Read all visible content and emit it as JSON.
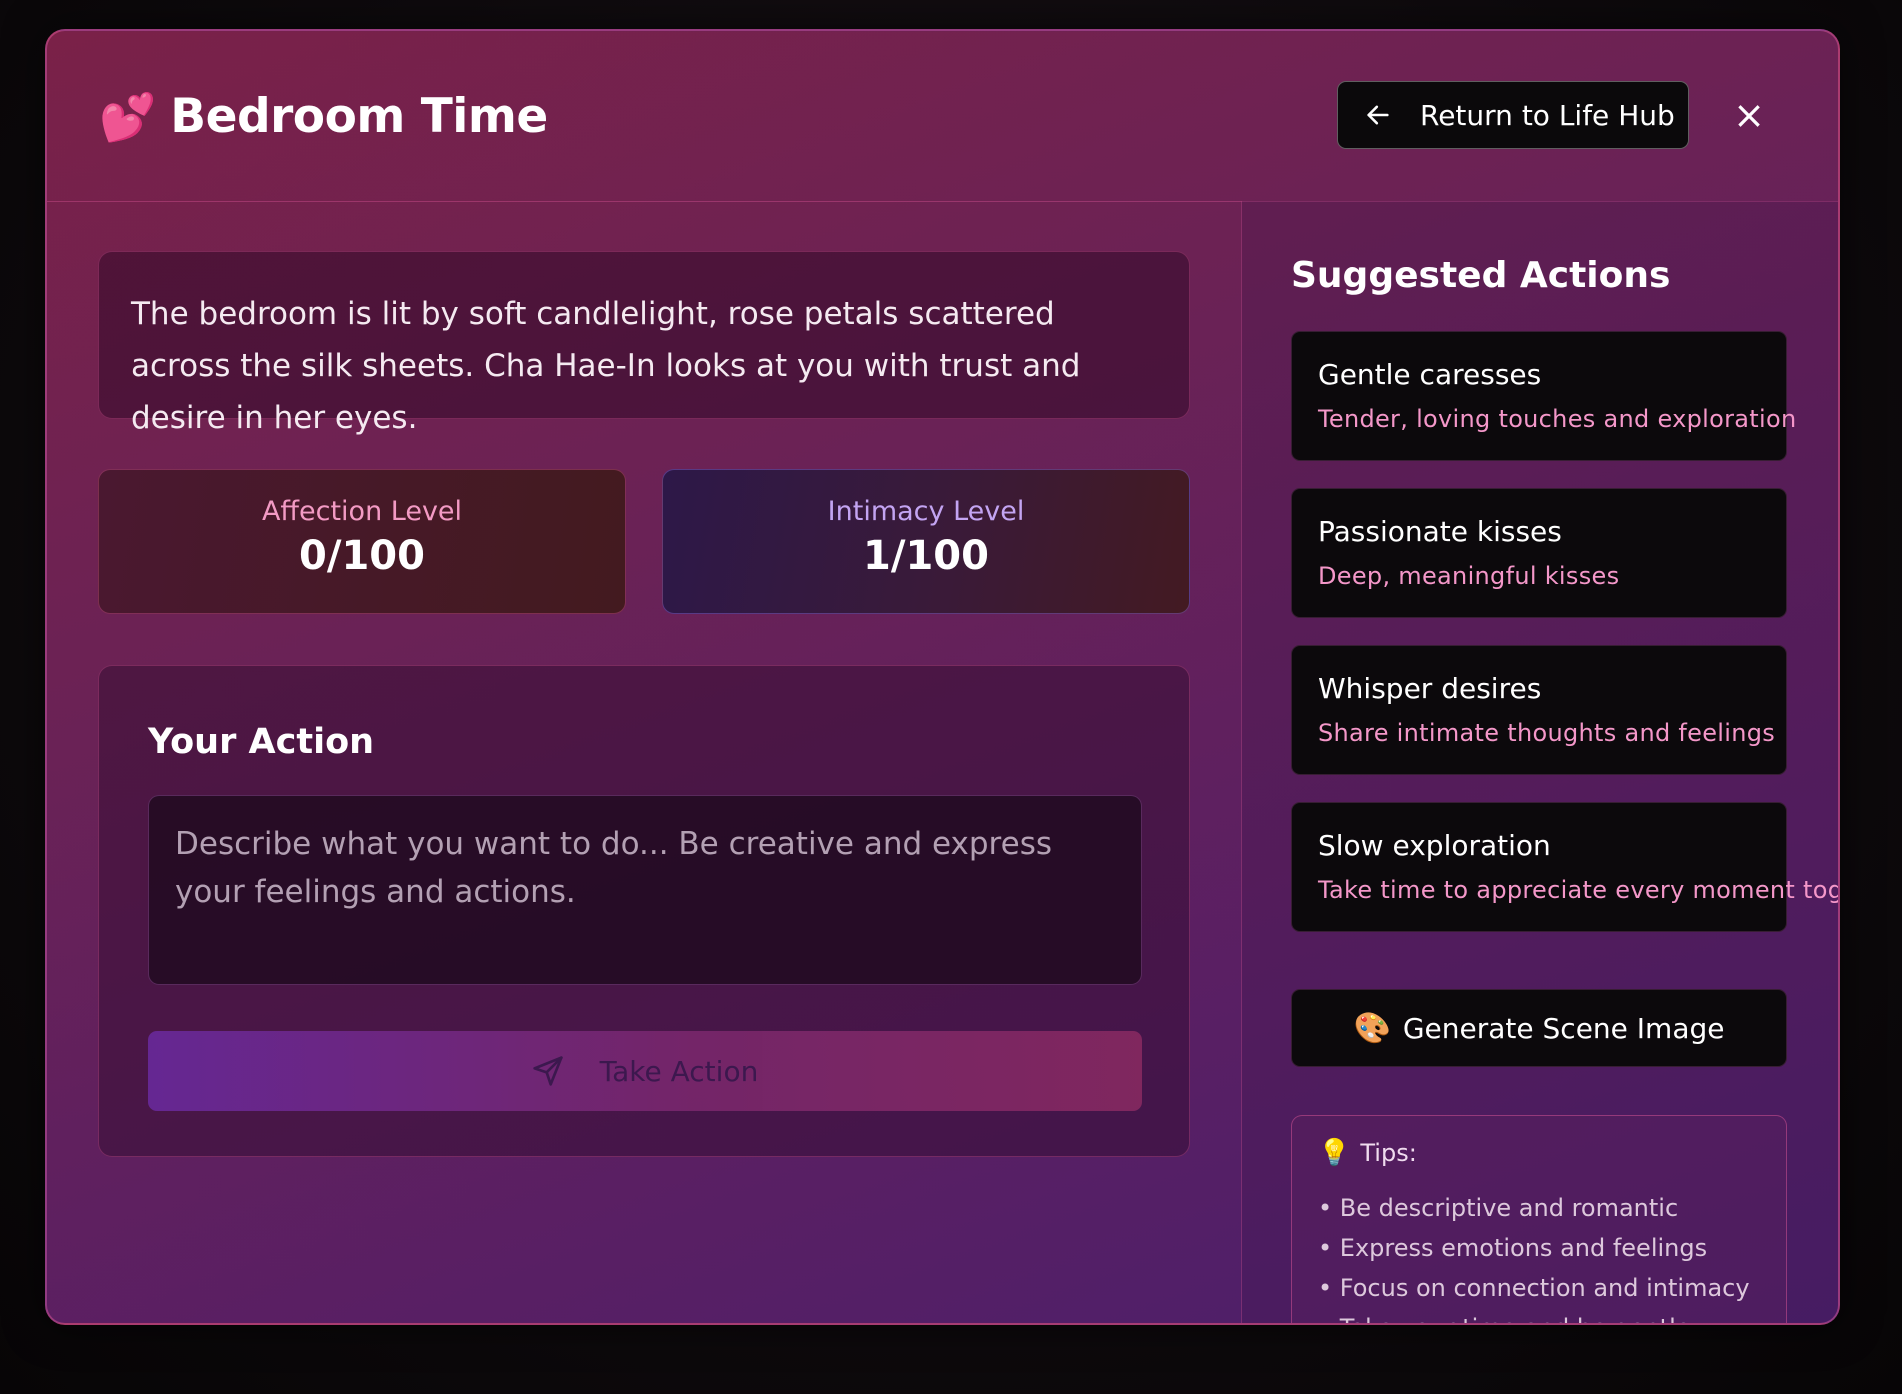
{
  "header": {
    "title": "Bedroom Time",
    "title_icon": "💕",
    "return_label": "Return to Life Hub",
    "close_symbol": "×"
  },
  "scene": {
    "description": "The bedroom is lit by soft candlelight, rose petals scattered across the silk sheets. Cha Hae-In looks at you with trust and desire in her eyes."
  },
  "stats": {
    "affection": {
      "label": "Affection Level",
      "value": "0/100"
    },
    "intimacy": {
      "label": "Intimacy Level",
      "value": "1/100"
    }
  },
  "action": {
    "title": "Your Action",
    "placeholder": "Describe what you want to do... Be creative and express your feelings and actions.",
    "submit_label": "Take Action"
  },
  "suggestions": {
    "title": "Suggested Actions",
    "items": [
      {
        "name": "Gentle caresses",
        "desc": "Tender, loving touches and exploration"
      },
      {
        "name": "Passionate kisses",
        "desc": "Deep, meaningful kisses"
      },
      {
        "name": "Whisper desires",
        "desc": "Share intimate thoughts and feelings"
      },
      {
        "name": "Slow exploration",
        "desc": "Take time to appreciate every moment together"
      }
    ],
    "generate_label": "Generate Scene Image",
    "generate_icon": "🎨"
  },
  "tips": {
    "icon": "💡",
    "title": "Tips:",
    "items": [
      "• Be descriptive and romantic",
      "• Express emotions and feelings",
      "• Focus on connection and intimacy",
      "• Take your time and be gentle"
    ]
  },
  "colors": {
    "accent_pink": "#f497c9",
    "accent_purple": "#c3a4f2",
    "panel_border": "#e95da0"
  }
}
